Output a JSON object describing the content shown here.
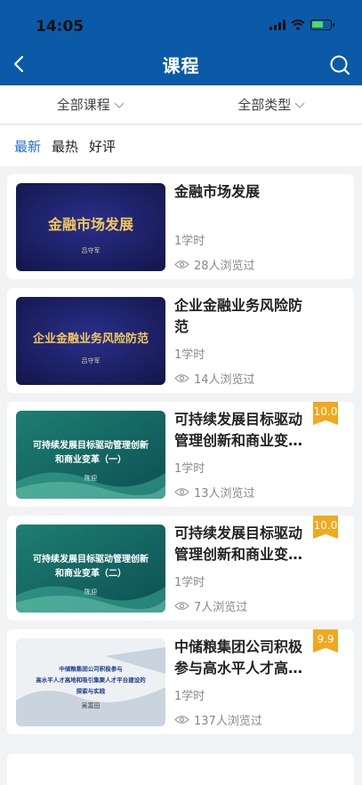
{
  "status_bar": {
    "time": "14:05"
  },
  "nav": {
    "title": "课程",
    "back_icon": "chevron-left-icon",
    "search_icon": "search-icon"
  },
  "filters": {
    "category": "全部课程",
    "type": "全部类型"
  },
  "sort_tabs": [
    {
      "label": "最新",
      "active": true
    },
    {
      "label": "最热",
      "active": false
    },
    {
      "label": "好评",
      "active": false
    }
  ],
  "colors": {
    "header": "#0b5aa8",
    "active_tab": "#1e6fc8",
    "badge": "#f2a81d"
  },
  "courses": [
    {
      "title": "金融市场发展",
      "hours": "1学时",
      "views": "28人浏览过",
      "rating": "",
      "thumb": {
        "style": "navy",
        "lines": [
          "金融市场发展"
        ],
        "author": "吕守军"
      }
    },
    {
      "title": "企业金融业务风险防范",
      "hours": "1学时",
      "views": "14人浏览过",
      "rating": "",
      "thumb": {
        "style": "navy",
        "lines": [
          "企业金融业务风险防范"
        ],
        "author": "吕守军"
      }
    },
    {
      "title": "可持续发展目标驱动管理创新和商业变…",
      "hours": "1学时",
      "views": "13人浏览过",
      "rating": "10.0",
      "thumb": {
        "style": "teal",
        "lines": [
          "可持续发展目标驱动管理创新",
          "和商业变革（一）"
        ],
        "author": "陈迎"
      }
    },
    {
      "title": "可持续发展目标驱动管理创新和商业变…",
      "hours": "1学时",
      "views": "7人浏览过",
      "rating": "10.0",
      "thumb": {
        "style": "teal",
        "lines": [
          "可持续发展目标驱动管理创新",
          "和商业变革（二）"
        ],
        "author": "陈迎"
      }
    },
    {
      "title": "中储粮集团公司积极参与高水平人才高…",
      "hours": "1学时",
      "views": "137人浏览过",
      "rating": "9.9",
      "thumb": {
        "style": "light",
        "lines": [
          "中储粮集团公司积极参与",
          "高水平人才高地和吸引集聚人才平台建设的",
          "探索与实践"
        ],
        "author": "吴富田"
      }
    }
  ]
}
